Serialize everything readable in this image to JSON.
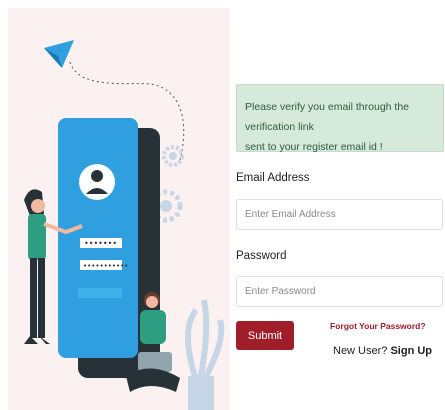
{
  "alert": {
    "line1": "Please verify you email through the verification link",
    "line2": "sent to your register email id !"
  },
  "form": {
    "email_label": "Email Address",
    "email_placeholder": "Enter Email Address",
    "password_label": "Password",
    "password_placeholder": "Enter Password",
    "submit_label": "Submit",
    "forgot_label": "Forgot Your Password?",
    "new_user_text": "New User?",
    "signup_label": "Sign Up"
  },
  "illustration": {
    "email_dots": "•••••••",
    "password_dots": "•••••••••••"
  },
  "colors": {
    "accent": "#a01d2a",
    "alert_bg": "#d6eadb",
    "phone_blue": "#2f9fe0",
    "panel_bg": "#fbf1f1"
  }
}
